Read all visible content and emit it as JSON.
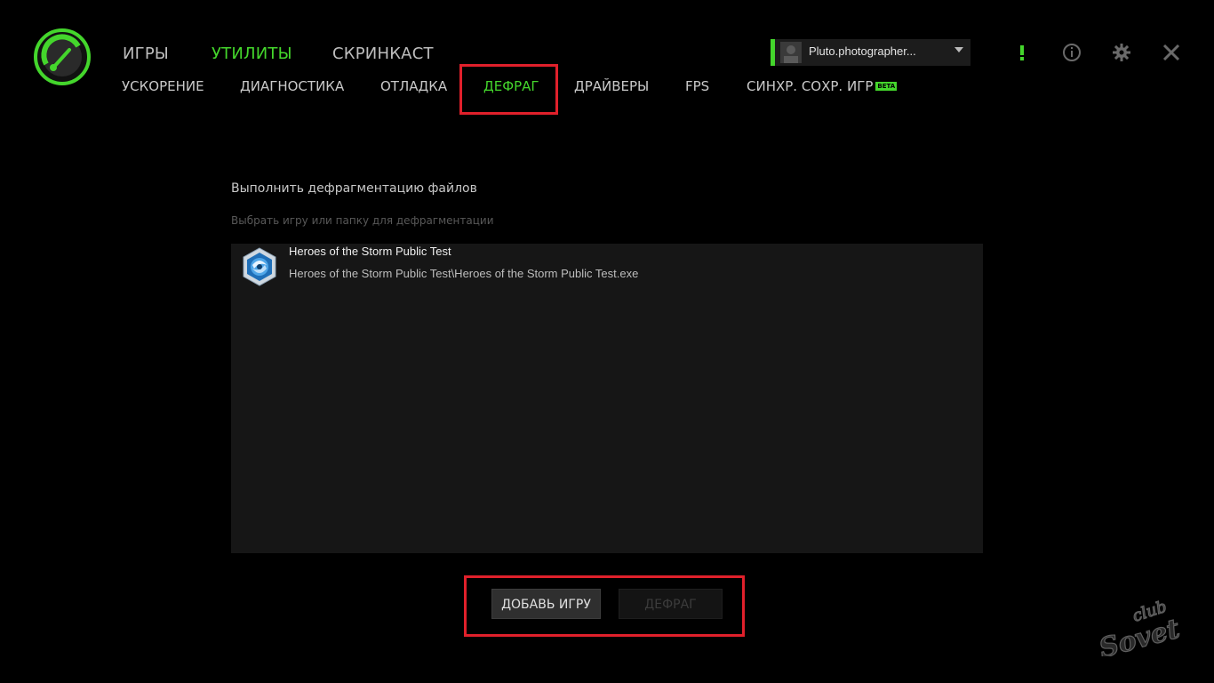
{
  "main_nav": {
    "games": "ИГРЫ",
    "utilities": "УТИЛИТЫ",
    "screencast": "СКРИНКАСТ"
  },
  "sub_nav": {
    "boost": "УСКОРЕНИЕ",
    "diagnostics": "ДИАГНОСТИКА",
    "debug": "ОТЛАДКА",
    "defrag": "ДЕФРАГ",
    "drivers": "ДРАЙВЕРЫ",
    "fps": "FPS",
    "save_sync": "СИНХР. СОХР. ИГР",
    "beta_badge": "BETA"
  },
  "account": {
    "name": "Pluto.photographer..."
  },
  "top_icons": [
    "alert-icon",
    "info-icon",
    "gear-icon",
    "close-icon"
  ],
  "content": {
    "title": "Выполнить дефрагментацию файлов",
    "subtitle": "Выбрать игру или папку для дефрагментации",
    "games": [
      {
        "name": "Heroes of the Storm Public Test",
        "path": "Heroes of the Storm Public Test\\Heroes of the Storm Public Test.exe",
        "icon": "heroes-of-the-storm-icon"
      }
    ]
  },
  "buttons": {
    "add_game": "ДОБАВЬ ИГРУ",
    "defrag": "ДЕФРАГ"
  },
  "watermark": {
    "line1": "club",
    "line2": "Sovet"
  },
  "colors": {
    "accent": "#44d62c",
    "highlight": "#e0202b",
    "background": "#000000",
    "panel": "#161616"
  }
}
